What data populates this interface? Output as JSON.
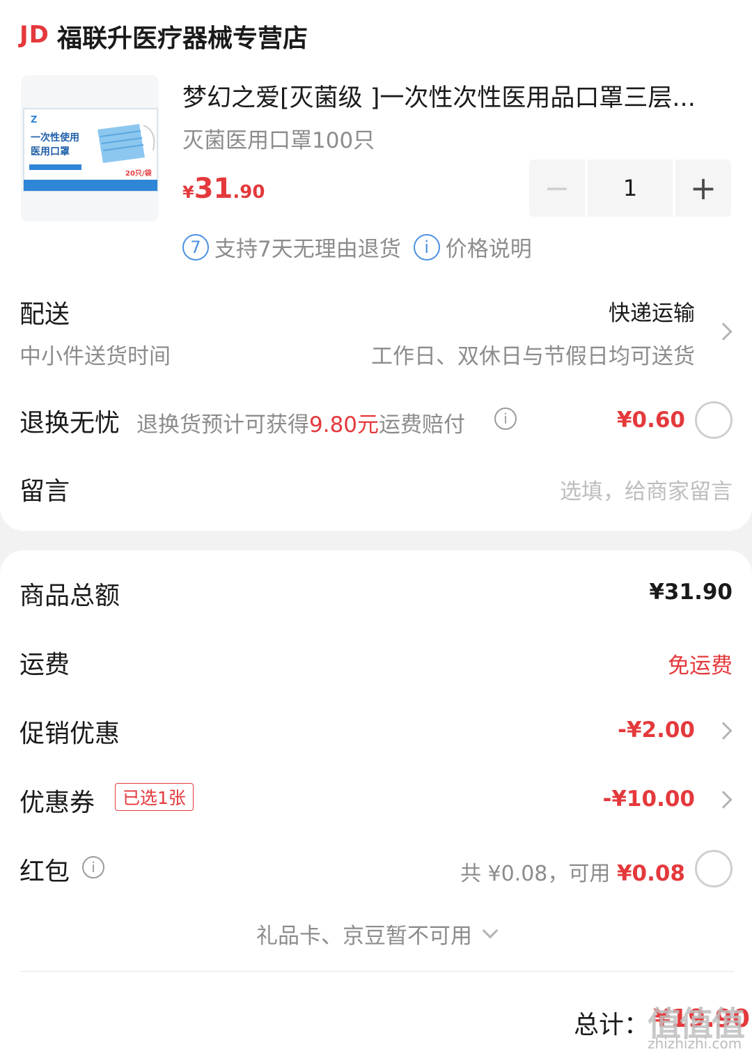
{
  "shop": {
    "logo": "JD",
    "name": "福联升医疗器械专营店"
  },
  "product": {
    "title": "梦幻之爱[灭菌级 ]一次性次性医用品口罩三层...",
    "spec": "灭菌医用口罩100只",
    "price_symbol": "¥",
    "price_int": "31",
    "price_dec": ".90",
    "quantity": "1",
    "minus": "−",
    "plus": "+",
    "image": {
      "brand": "Z",
      "text_line1": "一次性使用",
      "text_line2": "医用口罩",
      "count": "20只/袋",
      "icon": "mask-package-icon"
    },
    "tags": [
      {
        "icon_text": "7",
        "label": "支持7天无理由退货"
      },
      {
        "icon_text": "i",
        "label": "价格说明"
      }
    ]
  },
  "delivery": {
    "label": "配送",
    "value": "快递运输",
    "sub_label": "中小件送货时间",
    "sub_value": "工作日、双休日与节假日均可送货"
  },
  "return_service": {
    "label": "退换无忧",
    "desc_prefix": "退换货预计可获得",
    "desc_amount": "9.80元",
    "desc_suffix": "运费赔付",
    "info": "i",
    "price": "¥0.60"
  },
  "message": {
    "label": "留言",
    "placeholder": "选填，给商家留言"
  },
  "summary": {
    "goods_total_label": "商品总额",
    "goods_total_value": "¥31.90",
    "shipping_label": "运费",
    "shipping_value": "免运费",
    "promo_label": "促销优惠",
    "promo_value": "-¥2.00",
    "coupon_label": "优惠券",
    "coupon_badge": "已选1张",
    "coupon_value": "-¥10.00",
    "redpacket_label": "红包",
    "redpacket_info": "i",
    "redpacket_total": "共 ¥0.08，可用 ",
    "redpacket_available": "¥0.08",
    "giftcard_note": "礼品卡、京豆暂不可用"
  },
  "total": {
    "label": "总计：",
    "value": "¥19.90"
  },
  "watermark": {
    "main": "值值值",
    "sub": "zhizhizhi.com"
  },
  "colors": {
    "accent": "#e4393c",
    "info_blue": "#4a90e2"
  }
}
